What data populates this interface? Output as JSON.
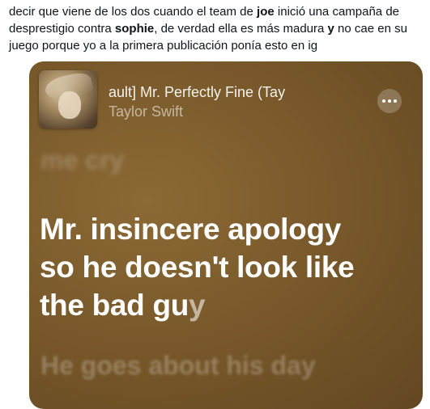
{
  "tweet": {
    "seg1": "decir que viene de los dos cuando el team de ",
    "bold1": "joe",
    "seg2": " inició una campaña de desprestigio contra ",
    "bold2": "sophie",
    "seg3": ", de verdad ella es más madura ",
    "bold3": "y",
    "seg4": " no cae en su juego porque yo a la primera publicación ponía esto en ig"
  },
  "player": {
    "song_title": "ault]       Mr. Perfectly Fine (Tay",
    "artist": "Taylor Swift",
    "more_icon": "ellipsis-icon"
  },
  "lyrics": {
    "previous": "me cry",
    "current_line1": "Mr. insincere apology",
    "current_line2": "so he doesn't look like",
    "current_line3_main": "the bad gu",
    "current_line3_dim": "y",
    "next": "He goes about his day"
  }
}
